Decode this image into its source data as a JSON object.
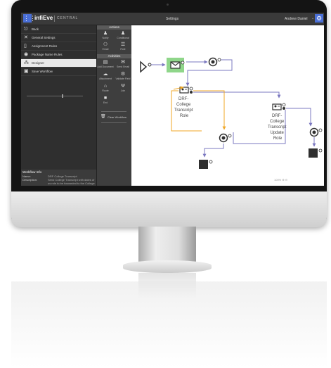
{
  "app": {
    "brand": "infiEve",
    "brand_sub": "CENTRAL",
    "page_title": "Settings",
    "user_name": "Andrew Daniel",
    "user_chevron": "⌄"
  },
  "sidebar": {
    "items": [
      {
        "label": "Back",
        "icon": "back-icon"
      },
      {
        "label": "General Settings",
        "icon": "tools-icon"
      },
      {
        "label": "Assignment Rules",
        "icon": "document-icon"
      },
      {
        "label": "Package Name Rules",
        "icon": "package-icon"
      },
      {
        "label": "Designer",
        "icon": "designer-icon",
        "active": true
      },
      {
        "label": "Save Workflow",
        "icon": "save-icon"
      }
    ],
    "workflow_info": {
      "heading": "Workflow Info",
      "name_label": "Name:",
      "name_value": "DRF College Transcript",
      "description_label": "Description:",
      "description_value": "Send College Transcript with dates of us role to be forwarded to the College Transcript Role. The Rol..."
    }
  },
  "palette": {
    "actions_header": "Actions",
    "activities_header": "Activities",
    "tools": [
      {
        "label": "Notify",
        "icon": "person-icon"
      },
      {
        "label": "Conditional",
        "icon": "person-icon"
      },
      {
        "label": "Email",
        "icon": "users-icon"
      },
      {
        "label": "Role",
        "icon": "role-icon"
      },
      {
        "label": "Add Document",
        "icon": "document-icon"
      },
      {
        "label": "Send Email",
        "icon": "email-icon"
      },
      {
        "label": "Attachment",
        "icon": "cloud-icon"
      },
      {
        "label": "Validate Field",
        "icon": "gear-icon"
      },
      {
        "label": "Route",
        "icon": "route-icon"
      },
      {
        "label": "Join",
        "icon": "join-icon"
      },
      {
        "label": "End",
        "icon": "stop-icon"
      }
    ],
    "clear_label": "Clear Workflow"
  },
  "workflow": {
    "role_label_1": [
      "DRF-",
      "College",
      "Transcript",
      "Role"
    ],
    "role_label_2": [
      "DRF-",
      "College",
      "Transcript",
      "Update",
      "Role"
    ],
    "colors": {
      "flow_blue": "#7b78c0",
      "flow_orange": "#f0a726",
      "email_node_fill": "#8fd68a",
      "node_dark": "#2f2f2f"
    }
  },
  "canvas_controls": {
    "zoom_label": "100%  ⊕  ⊖"
  },
  "colors": {
    "accent": "#4a6fd6",
    "sidebar_bg": "#2f2f2f",
    "palette_bg": "#3e3e3e",
    "active_item_bg": "#e9e9e9"
  }
}
